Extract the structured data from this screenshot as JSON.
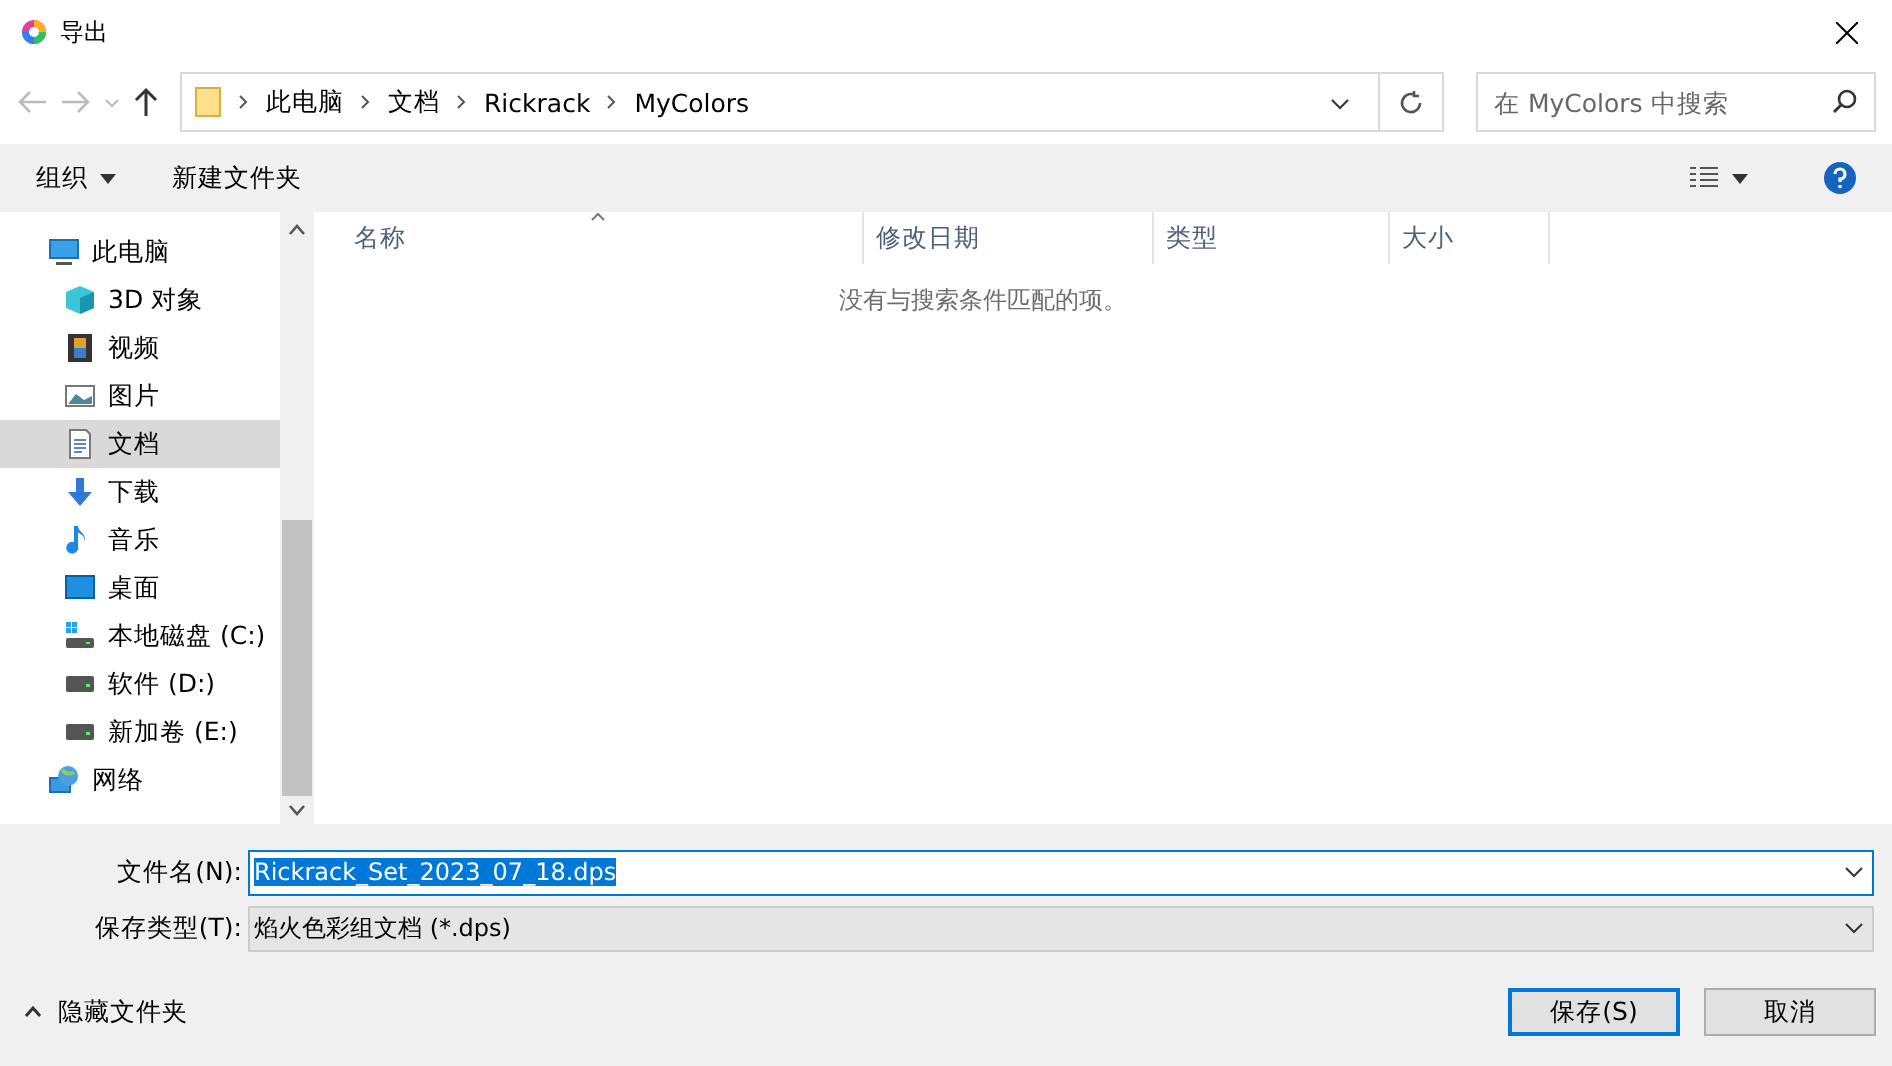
{
  "window": {
    "title": "导出"
  },
  "address": {
    "breadcrumbs": [
      "此电脑",
      "文档",
      "Rickrack",
      "MyColors"
    ]
  },
  "search": {
    "placeholder": "在 MyColors 中搜索"
  },
  "toolbar": {
    "organize": "组织",
    "new_folder": "新建文件夹"
  },
  "sidebar": {
    "items": [
      {
        "label": "此电脑",
        "kind": "pc",
        "selected": false,
        "children": [
          {
            "label": "3D 对象",
            "kind": "cube",
            "selected": false
          },
          {
            "label": "视频",
            "kind": "film",
            "selected": false
          },
          {
            "label": "图片",
            "kind": "image",
            "selected": false
          },
          {
            "label": "文档",
            "kind": "doc",
            "selected": true
          },
          {
            "label": "下载",
            "kind": "download",
            "selected": false
          },
          {
            "label": "音乐",
            "kind": "music",
            "selected": false
          },
          {
            "label": "桌面",
            "kind": "desktop",
            "selected": false
          },
          {
            "label": "本地磁盘 (C:)",
            "kind": "system-drive",
            "selected": false
          },
          {
            "label": "软件 (D:)",
            "kind": "drive",
            "selected": false
          },
          {
            "label": "新加卷 (E:)",
            "kind": "drive",
            "selected": false
          }
        ]
      },
      {
        "label": "网络",
        "kind": "network",
        "selected": false
      }
    ]
  },
  "table": {
    "columns": [
      "名称",
      "修改日期",
      "类型",
      "大小"
    ],
    "empty_message": "没有与搜索条件匹配的项。"
  },
  "form": {
    "filename_label": "文件名(N):",
    "filename": "Rickrack_Set_2023_07_18.dps",
    "filetype_label": "保存类型(T):",
    "filetype": "焰火色彩组文档 (*.dps)"
  },
  "hide_folders": "隐藏文件夹",
  "buttons": [
    "保存(S)",
    "取消"
  ]
}
